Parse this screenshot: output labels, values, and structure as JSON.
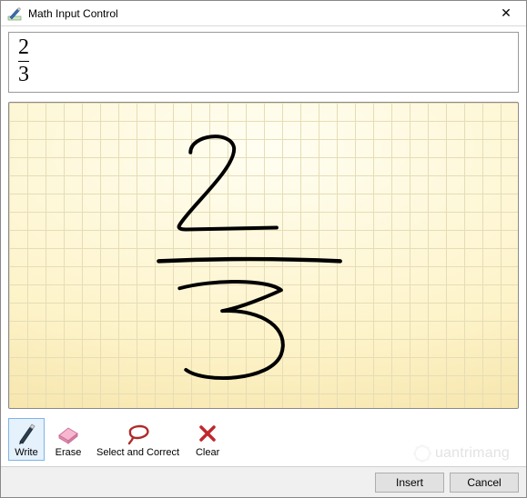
{
  "window": {
    "title": "Math Input Control",
    "close_glyph": "✕"
  },
  "preview": {
    "numerator": "2",
    "denominator": "3"
  },
  "toolbar": {
    "write": "Write",
    "erase": "Erase",
    "select_correct": "Select and Correct",
    "clear": "Clear"
  },
  "footer": {
    "insert": "Insert",
    "cancel": "Cancel"
  },
  "watermark": {
    "text": "uantrimang"
  }
}
